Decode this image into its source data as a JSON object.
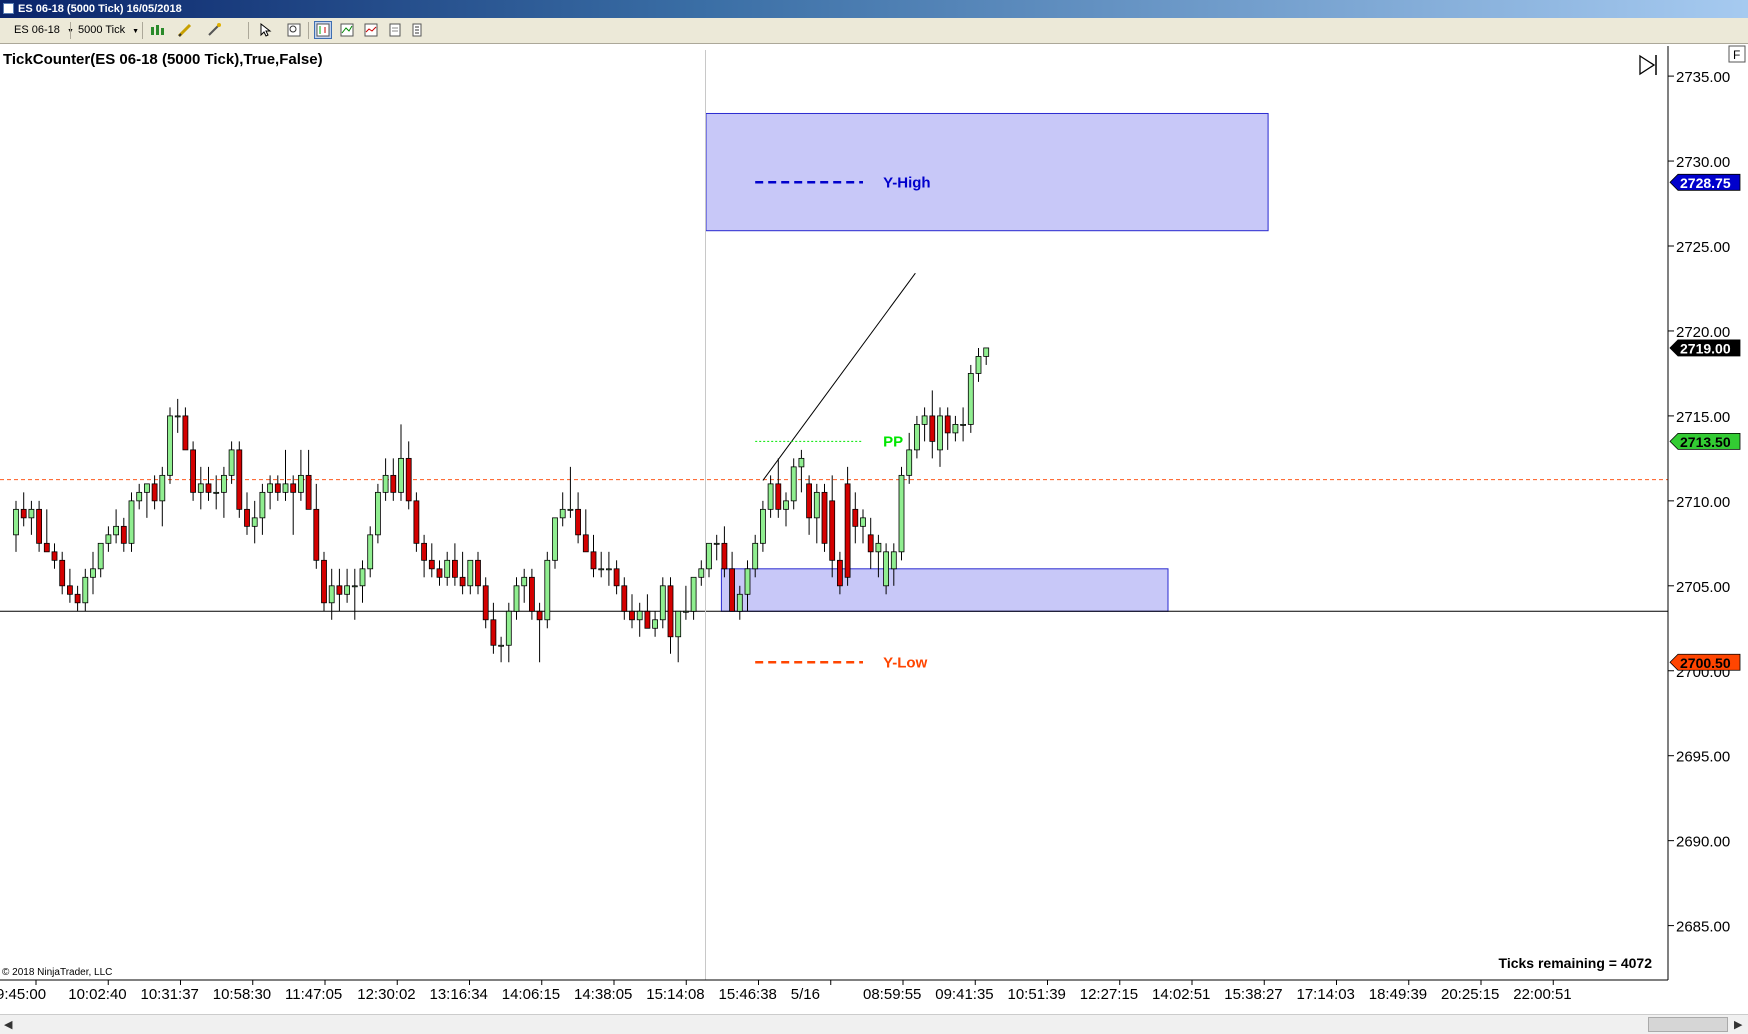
{
  "window": {
    "title": "ES 06-18 (5000 Tick)  16/05/2018"
  },
  "toolbar": {
    "instrument": "ES 06-18",
    "interval": "5000 Tick",
    "dropdown_glyph": "▼"
  },
  "colors": {
    "up": "#90ee90",
    "down": "#d40000",
    "zone_fill": "#c8c8f8",
    "zone_stroke": "#2a2ad0",
    "y_high": "#0000cc",
    "y_low": "#ff4500",
    "pp": "#00e600"
  },
  "icons": [
    "bar-chart-icon",
    "pencil-icon",
    "wand-icon",
    "pointer-icon",
    "zoom-icon",
    "chart-style-icon",
    "indicator-icon",
    "strategy-icon",
    "properties-icon",
    "play-end-icon"
  ],
  "chart_data": {
    "type": "candlestick",
    "indicator_label": "TickCounter(ES 06-18 (5000 Tick),True,False)",
    "ticks_remaining": "Ticks remaining = 4072",
    "copyright": "© 2018 NinjaTrader, LLC",
    "panel_corner": "F",
    "y_ticks": [
      "2735.00",
      "2730.00",
      "2725.00",
      "2720.00",
      "2715.00",
      "2710.00",
      "2705.00",
      "2700.00",
      "2695.00",
      "2690.00",
      "2685.00"
    ],
    "ylim": [
      2682.25,
      2736.75
    ],
    "x_tick_labels": [
      "9:45:00",
      "10:02:40",
      "10:31:37",
      "10:58:30",
      "11:47:05",
      "12:30:02",
      "13:16:34",
      "14:06:15",
      "14:38:05",
      "15:14:08",
      "15:46:38",
      "5/16",
      "08:59:55",
      "09:41:35",
      "10:51:39",
      "12:27:15",
      "14:02:51",
      "15:38:27",
      "17:14:03",
      "18:49:39",
      "20:25:15",
      "22:00:51"
    ],
    "session_separator_after_bar": 90,
    "price_markers": [
      {
        "label": "2728.75",
        "value": 2728.75,
        "bg": "#0000cc",
        "fg": "#ffffff"
      },
      {
        "label": "2719.00",
        "value": 2719.0,
        "bg": "#000000",
        "fg": "#ffffff"
      },
      {
        "label": "2713.50",
        "value": 2713.5,
        "bg": "#33cc33",
        "fg": "#000000"
      },
      {
        "label": "2700.50",
        "value": 2700.5,
        "bg": "#ff4500",
        "fg": "#000000"
      }
    ],
    "zones": [
      {
        "name": "upper-zone",
        "from_bar": 90,
        "to_bar": 163,
        "high": 2732.8,
        "low": 2725.9
      },
      {
        "name": "lower-zone",
        "from_bar": 92,
        "to_bar": 150,
        "high": 2706.0,
        "low": 2703.5
      }
    ],
    "levels": [
      {
        "name": "Y-High",
        "value": 2728.75,
        "from_bar": 96,
        "to_bar": 110,
        "dash": "8,5",
        "width": 2.5,
        "color": "#0000cc"
      },
      {
        "name": "Y-Low",
        "value": 2700.5,
        "from_bar": 96,
        "to_bar": 110,
        "dash": "8,5",
        "width": 2.5,
        "color": "#ff4500"
      },
      {
        "name": "PP",
        "value": 2713.5,
        "from_bar": 96,
        "to_bar": 110,
        "dash": "2,2",
        "width": 1,
        "color": "#00e600"
      }
    ],
    "level_label_bar": 113,
    "horizontal_lines": [
      {
        "value": 2711.25,
        "color": "#ff5a1e",
        "dash": "4,3"
      },
      {
        "value": 2703.5,
        "color": "#000000",
        "dash": ""
      }
    ],
    "trend_line": {
      "x1": 97.0,
      "y1": 2711.2,
      "x2": 116.8,
      "y2": 2723.4
    },
    "candles": [
      [
        2708.0,
        2710.0,
        2707.0,
        2709.5
      ],
      [
        2709.5,
        2710.5,
        2708.5,
        2709.0
      ],
      [
        2709.0,
        2710.0,
        2708.0,
        2709.5
      ],
      [
        2709.5,
        2710.0,
        2707.0,
        2707.5
      ],
      [
        2707.5,
        2709.5,
        2707.0,
        2707.0
      ],
      [
        2707.0,
        2707.5,
        2706.0,
        2706.5
      ],
      [
        2706.5,
        2707.0,
        2704.5,
        2705.0
      ],
      [
        2705.0,
        2706.0,
        2704.0,
        2704.5
      ],
      [
        2704.5,
        2705.0,
        2703.5,
        2704.0
      ],
      [
        2704.0,
        2706.0,
        2703.5,
        2705.5
      ],
      [
        2705.5,
        2707.0,
        2704.5,
        2706.0
      ],
      [
        2706.0,
        2707.5,
        2705.5,
        2707.5
      ],
      [
        2707.5,
        2708.5,
        2707.0,
        2708.0
      ],
      [
        2708.0,
        2709.5,
        2707.5,
        2708.5
      ],
      [
        2708.5,
        2709.0,
        2707.0,
        2707.5
      ],
      [
        2707.5,
        2710.5,
        2707.0,
        2710.0
      ],
      [
        2710.0,
        2711.0,
        2709.5,
        2710.5
      ],
      [
        2710.5,
        2711.0,
        2709.0,
        2711.0
      ],
      [
        2711.0,
        2711.5,
        2709.5,
        2710.0
      ],
      [
        2710.0,
        2712.0,
        2708.5,
        2711.5
      ],
      [
        2711.5,
        2715.5,
        2711.0,
        2715.0
      ],
      [
        2715.0,
        2716.0,
        2714.0,
        2715.0
      ],
      [
        2715.0,
        2715.5,
        2713.0,
        2713.0
      ],
      [
        2713.0,
        2713.5,
        2710.0,
        2710.5
      ],
      [
        2710.5,
        2712.0,
        2709.5,
        2711.0
      ],
      [
        2711.0,
        2712.0,
        2710.0,
        2710.5
      ],
      [
        2710.5,
        2711.5,
        2709.5,
        2710.5
      ],
      [
        2710.5,
        2712.0,
        2709.0,
        2711.5
      ],
      [
        2711.5,
        2713.5,
        2711.0,
        2713.0
      ],
      [
        2713.0,
        2713.5,
        2709.0,
        2709.5
      ],
      [
        2709.5,
        2710.5,
        2708.0,
        2708.5
      ],
      [
        2708.5,
        2710.0,
        2707.5,
        2709.0
      ],
      [
        2709.0,
        2711.0,
        2708.0,
        2710.5
      ],
      [
        2710.5,
        2711.5,
        2709.5,
        2711.0
      ],
      [
        2711.0,
        2711.5,
        2710.0,
        2710.5
      ],
      [
        2710.5,
        2713.0,
        2710.0,
        2711.0
      ],
      [
        2711.0,
        2711.5,
        2708.0,
        2710.5
      ],
      [
        2710.5,
        2713.0,
        2710.0,
        2711.5
      ],
      [
        2711.5,
        2713.0,
        2709.5,
        2709.5
      ],
      [
        2709.5,
        2711.0,
        2706.0,
        2706.5
      ],
      [
        2706.5,
        2707.0,
        2703.5,
        2704.0
      ],
      [
        2704.0,
        2706.0,
        2703.0,
        2705.0
      ],
      [
        2705.0,
        2706.0,
        2703.5,
        2704.5
      ],
      [
        2704.5,
        2706.0,
        2704.0,
        2705.0
      ],
      [
        2705.0,
        2706.0,
        2703.0,
        2705.0
      ],
      [
        2705.0,
        2706.5,
        2704.0,
        2706.0
      ],
      [
        2706.0,
        2708.5,
        2705.5,
        2708.0
      ],
      [
        2708.0,
        2711.0,
        2707.5,
        2710.5
      ],
      [
        2710.5,
        2712.5,
        2710.0,
        2711.5
      ],
      [
        2711.5,
        2712.5,
        2710.0,
        2710.5
      ],
      [
        2710.5,
        2714.5,
        2710.0,
        2712.5
      ],
      [
        2712.5,
        2713.5,
        2709.5,
        2710.0
      ],
      [
        2710.0,
        2710.5,
        2707.0,
        2707.5
      ],
      [
        2707.5,
        2708.0,
        2705.5,
        2706.5
      ],
      [
        2706.5,
        2707.5,
        2705.5,
        2706.0
      ],
      [
        2706.0,
        2706.5,
        2705.0,
        2705.5
      ],
      [
        2705.5,
        2707.0,
        2705.0,
        2706.5
      ],
      [
        2706.5,
        2707.5,
        2705.0,
        2705.5
      ],
      [
        2705.5,
        2707.0,
        2704.5,
        2705.0
      ],
      [
        2705.0,
        2706.5,
        2704.5,
        2706.5
      ],
      [
        2706.5,
        2707.0,
        2704.5,
        2705.0
      ],
      [
        2705.0,
        2705.5,
        2702.5,
        2703.0
      ],
      [
        2703.0,
        2704.0,
        2701.0,
        2701.5
      ],
      [
        2701.5,
        2702.0,
        2700.5,
        2701.5
      ],
      [
        2701.5,
        2704.0,
        2700.5,
        2703.5
      ],
      [
        2703.5,
        2705.5,
        2703.0,
        2705.0
      ],
      [
        2705.0,
        2706.0,
        2704.0,
        2705.5
      ],
      [
        2705.5,
        2706.0,
        2703.0,
        2703.5
      ],
      [
        2703.5,
        2704.0,
        2700.5,
        2703.0
      ],
      [
        2703.0,
        2707.0,
        2702.5,
        2706.5
      ],
      [
        2706.5,
        2709.0,
        2706.0,
        2709.0
      ],
      [
        2709.0,
        2710.5,
        2708.5,
        2709.5
      ],
      [
        2709.5,
        2712.0,
        2709.0,
        2709.5
      ],
      [
        2709.5,
        2710.5,
        2707.5,
        2708.0
      ],
      [
        2708.0,
        2709.5,
        2707.0,
        2707.0
      ],
      [
        2707.0,
        2708.0,
        2705.5,
        2706.0
      ],
      [
        2706.0,
        2707.0,
        2705.5,
        2706.0
      ],
      [
        2706.0,
        2707.0,
        2705.0,
        2706.0
      ],
      [
        2706.0,
        2706.5,
        2704.5,
        2705.0
      ],
      [
        2705.0,
        2705.5,
        2703.0,
        2703.5
      ],
      [
        2703.5,
        2704.5,
        2702.5,
        2703.0
      ],
      [
        2703.0,
        2704.0,
        2702.0,
        2703.5
      ],
      [
        2703.5,
        2704.5,
        2702.5,
        2702.5
      ],
      [
        2702.5,
        2703.5,
        2702.0,
        2703.0
      ],
      [
        2703.0,
        2705.5,
        2702.5,
        2705.0
      ],
      [
        2705.0,
        2705.5,
        2701.0,
        2702.0
      ],
      [
        2702.0,
        2703.5,
        2700.5,
        2703.5
      ],
      [
        2703.5,
        2705.0,
        2703.0,
        2703.5
      ],
      [
        2703.5,
        2705.5,
        2703.0,
        2705.5
      ],
      [
        2705.5,
        2706.5,
        2705.0,
        2706.0
      ],
      [
        2706.0,
        2707.5,
        2705.5,
        2707.5
      ],
      [
        2707.5,
        2708.0,
        2706.5,
        2707.5
      ],
      [
        2707.5,
        2708.5,
        2705.5,
        2706.0
      ],
      [
        2706.0,
        2707.0,
        2703.5,
        2703.5
      ],
      [
        2703.5,
        2705.0,
        2703.0,
        2704.5
      ],
      [
        2704.5,
        2706.5,
        2703.5,
        2706.0
      ],
      [
        2706.0,
        2708.0,
        2705.5,
        2707.5
      ],
      [
        2707.5,
        2710.0,
        2707.0,
        2709.5
      ],
      [
        2709.5,
        2711.5,
        2709.0,
        2711.0
      ],
      [
        2711.0,
        2712.5,
        2709.0,
        2709.5
      ],
      [
        2709.5,
        2710.5,
        2708.5,
        2710.0
      ],
      [
        2710.0,
        2712.5,
        2709.5,
        2712.0
      ],
      [
        2712.0,
        2713.0,
        2710.5,
        2712.5
      ],
      [
        2711.0,
        2711.5,
        2708.0,
        2709.0
      ],
      [
        2709.0,
        2711.0,
        2707.5,
        2710.5
      ],
      [
        2710.5,
        2711.0,
        2707.0,
        2707.5
      ],
      [
        2710.0,
        2711.5,
        2705.5,
        2706.5
      ],
      [
        2706.5,
        2707.0,
        2704.5,
        2705.0
      ],
      [
        2711.0,
        2712.0,
        2705.0,
        2705.5
      ],
      [
        2709.5,
        2710.5,
        2707.5,
        2708.5
      ],
      [
        2708.5,
        2709.5,
        2707.5,
        2709.0
      ],
      [
        2708.0,
        2709.0,
        2706.0,
        2707.0
      ],
      [
        2707.0,
        2708.0,
        2705.5,
        2707.5
      ],
      [
        2705.0,
        2707.5,
        2704.5,
        2707.0
      ],
      [
        2706.0,
        2707.5,
        2705.0,
        2707.0
      ],
      [
        2707.0,
        2712.0,
        2706.5,
        2711.5
      ],
      [
        2711.5,
        2714.0,
        2711.0,
        2713.0
      ],
      [
        2713.0,
        2715.0,
        2712.5,
        2714.5
      ],
      [
        2714.5,
        2715.5,
        2713.5,
        2715.0
      ],
      [
        2715.0,
        2716.5,
        2712.5,
        2713.5
      ],
      [
        2713.0,
        2715.5,
        2712.0,
        2715.0
      ],
      [
        2715.0,
        2715.5,
        2713.0,
        2714.0
      ],
      [
        2714.0,
        2715.0,
        2713.5,
        2714.5
      ],
      [
        2714.5,
        2715.5,
        2713.5,
        2714.5
      ],
      [
        2714.5,
        2718.0,
        2714.0,
        2717.5
      ],
      [
        2717.5,
        2719.0,
        2717.0,
        2718.5
      ],
      [
        2718.5,
        2719.0,
        2718.0,
        2719.0
      ]
    ]
  }
}
